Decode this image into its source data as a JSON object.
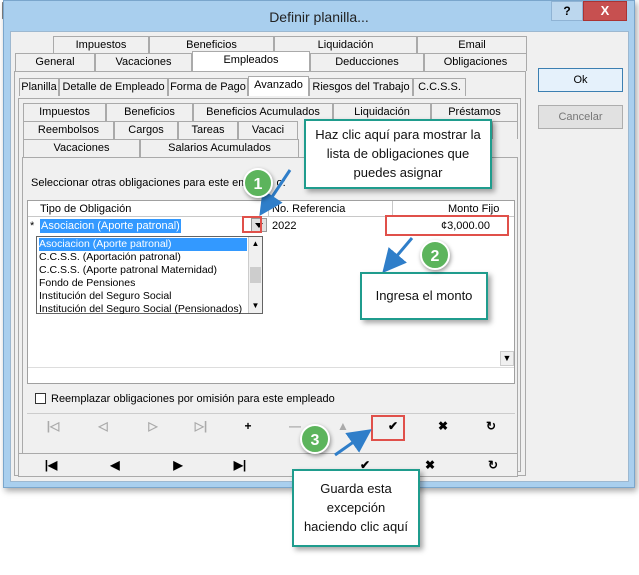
{
  "window": {
    "title": "Definir planilla...",
    "help_label": "?",
    "close_label": "X"
  },
  "tabs_row1": [
    "Impuestos",
    "Beneficios",
    "Liquidación",
    "Email"
  ],
  "tabs_row2": [
    "General",
    "Vacaciones",
    "Empleados",
    "Deducciones",
    "Obligaciones"
  ],
  "tabs_row3": [
    "Planilla",
    "Detalle de Empleado",
    "Forma de Pago",
    "Avanzado",
    "Riesgos del Trabajo",
    "C.C.S.S."
  ],
  "tabs_row4": [
    "Impuestos",
    "Beneficios",
    "Beneficios Acumulados",
    "Liquidación",
    "Préstamos"
  ],
  "tabs_row5": [
    "Reembolsos",
    "Cargos",
    "Tareas",
    "Vacaci"
  ],
  "tabs_row6": [
    "Vacaciones",
    "Salarios Acumulados"
  ],
  "side_buttons": {
    "ok": "Ok",
    "cancel": "Cancelar"
  },
  "panel": {
    "instruction": "Seleccionar otras obligaciones para este em",
    "instruction_tail": "o:",
    "col_tipo": "Tipo de Obligación",
    "col_ref": "No. Referencia",
    "col_monto": "Monto Fijo",
    "row_marker": "*",
    "row_tipo": "Asociacion (Aporte patronal)",
    "row_ref": "2022",
    "row_monto": "¢3,000.00",
    "checkbox_label": "Reemplazar obligaciones por omisión para este empleado"
  },
  "dropdown_items": [
    "Asociacion (Aporte patronal)",
    "C.C.S.S. (Aportación patronal)",
    "C.C.S.S. (Aporte patronal Maternidad)",
    "Fondo de Pensiones",
    "Institución del Seguro Social",
    "Institución del Seguro Social (Pensionados)"
  ],
  "inner_nav": {
    "add": "+",
    "confirm": "✔",
    "cancel": "✖",
    "refresh": "↻"
  },
  "outer_nav": {
    "first": "|◀",
    "prev": "◀",
    "next": "▶",
    "last": "▶|",
    "confirm": "✔",
    "cancel": "✖",
    "refresh": "↻"
  },
  "callouts": {
    "c1_text": "Haz clic aquí para mostrar la lista de obligaciones que puedes asignar",
    "c2_text": "Ingresa el monto",
    "c3_text": "Guarda esta excepción haciendo clic aquí",
    "badge1": "1",
    "badge2": "2",
    "badge3": "3"
  },
  "colors": {
    "accent": "#1f9c8d",
    "badge": "#5cb45c",
    "highlight": "#e0504a",
    "arrow": "#2f7ec9",
    "selection": "#3399ff"
  }
}
